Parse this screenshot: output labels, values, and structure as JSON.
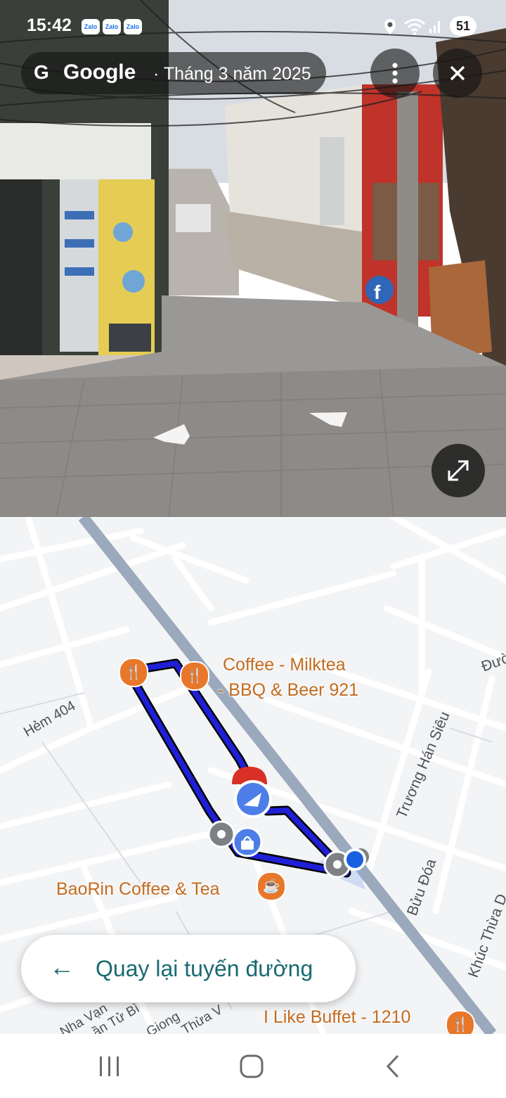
{
  "status_bar": {
    "time": "15:42",
    "notification_icons": [
      "Zalo",
      "Zalo",
      "Zalo"
    ],
    "battery": "51",
    "icons": [
      "location-icon",
      "wifi-icon",
      "signal-icon"
    ]
  },
  "street_view": {
    "brand": "Google",
    "date": "· Tháng 3 năm 2025",
    "g_letter": "G",
    "more_icon": "more-vert-icon",
    "close_icon": "close-icon",
    "expand_icon": "expand-icon"
  },
  "map": {
    "streets": {
      "hem_404": "Hẻm 404",
      "truong_han_sieu": "Trương Hán Siêu",
      "buu_doa": "Bửu Đóa",
      "khuc_thua": "Khúc Thừa D",
      "duong": "Đườ",
      "frag_nha_van": "Nha Vạn",
      "frag_tu_bi": "ần Tử Bì",
      "frag_giong": "Giong",
      "frag_thua": "Thừa V"
    },
    "pois": [
      {
        "line1": "Coffee - Milktea",
        "line2": "- BBQ & Beer 921",
        "icon": "restaurant-icon"
      },
      {
        "line1": "BaoRin Coffee & Tea",
        "icon": "cafe-icon"
      },
      {
        "line1": "I Like Buffet - 1210",
        "icon": "restaurant-icon"
      }
    ],
    "accent_route": "#1f1fd6",
    "accent_poi": "#e8772a"
  },
  "back_to_route": {
    "arrow": "←",
    "label": "Quay lại tuyến đường"
  },
  "nav_bar": {
    "recents_icon": "recents-icon",
    "home_icon": "home-icon",
    "back_icon": "back-icon"
  }
}
